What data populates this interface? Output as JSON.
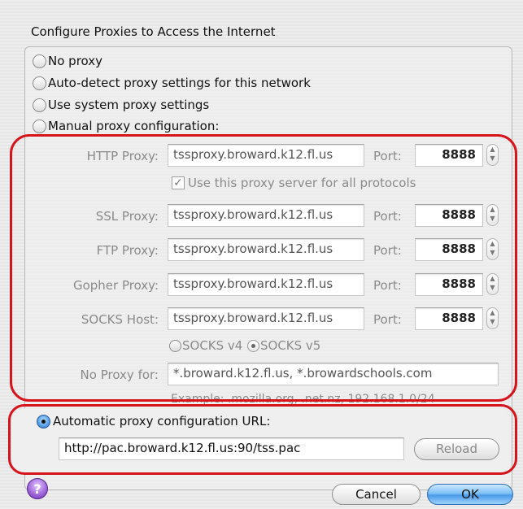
{
  "section_title": "Configure Proxies to Access the Internet",
  "options": {
    "no_proxy": "No proxy",
    "auto_detect": "Auto-detect proxy settings for this network",
    "system": "Use system proxy settings",
    "manual": "Manual proxy configuration:"
  },
  "manual": {
    "http_label": "HTTP Proxy:",
    "http_value": "tssproxy.broward.k12.fl.us",
    "http_port": "8888",
    "port_label": "Port:",
    "share_label": "Use this proxy server for all protocols",
    "ssl_label": "SSL Proxy:",
    "ssl_value": "tssproxy.broward.k12.fl.us",
    "ssl_port": "8888",
    "ftp_label": "FTP Proxy:",
    "ftp_value": "tssproxy.broward.k12.fl.us",
    "ftp_port": "8888",
    "gopher_label": "Gopher Proxy:",
    "gopher_value": "tssproxy.broward.k12.fl.us",
    "gopher_port": "8888",
    "socks_label": "SOCKS Host:",
    "socks_value": "tssproxy.broward.k12.fl.us",
    "socks_port": "8888",
    "socks_v4": "SOCKS v4",
    "socks_v5": "SOCKS v5",
    "noproxy_label": "No Proxy for:",
    "noproxy_value": "*.broward.k12.fl.us, *.browardschools.com",
    "example": "Example: .mozilla.org, .net.nz, 192.168.1.0/24"
  },
  "auto": {
    "label": "Automatic proxy configuration URL:",
    "url": "http://pac.broward.k12.fl.us:90/tss.pac",
    "reload": "Reload"
  },
  "buttons": {
    "help": "?",
    "cancel": "Cancel",
    "ok": "OK"
  },
  "selected_option": "auto",
  "highlight_color": "#d7131c"
}
